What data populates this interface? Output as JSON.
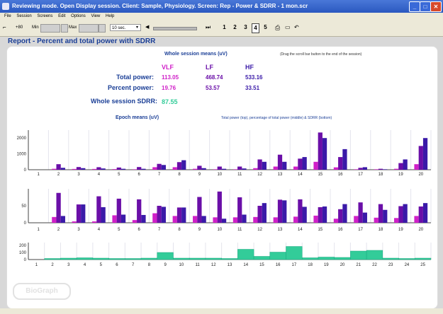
{
  "window": {
    "title": "Reviewing mode. Open Display session. Client: Sample, Physiology. Screen: Rep - Power & SDRR - 1 mon.scr",
    "minimize_label": "_",
    "maximize_label": "□",
    "close_label": "✕"
  },
  "menu": {
    "items": [
      "File",
      "Session",
      "Screens",
      "Edit",
      "Options",
      "View",
      "Help"
    ]
  },
  "toolbar": {
    "gain_label": "+80",
    "min_label": "Min",
    "max_label": "Max",
    "time_select": "10 sec.",
    "pages": [
      "1",
      "2",
      "3",
      "4",
      "5"
    ],
    "selected_page": "4"
  },
  "report_title": "Report - Percent and total power with SDRR",
  "stats": {
    "header": "Whole session means (uV)",
    "drag_hint": "(Drag the scroll bar button to the end of the session)",
    "columns": [
      "VLF",
      "LF",
      "HF"
    ],
    "rows": [
      {
        "label": "Total power:",
        "values": [
          "113.05",
          "468.74",
          "533.16"
        ]
      },
      {
        "label": "Percent power:",
        "values": [
          "19.76",
          "53.57",
          "33.51"
        ]
      }
    ],
    "sdrr_label": "Whole session SDRR:",
    "sdrr_value": "87.55"
  },
  "epoch_header": "Epoch means (uV)",
  "epoch_note": "Total power (top), percentage of total power (middle) & SDRR (bottom)",
  "logo_text": "BioGraph",
  "colors": {
    "vlf": "#d020c8",
    "lf": "#6a0fa8",
    "hf": "#3a1aa8",
    "sdrr": "#33cc99",
    "title": "#1a3e96"
  },
  "chart_data": [
    {
      "type": "bar",
      "title": "Total power",
      "categories": [
        "1",
        "2",
        "3",
        "4",
        "5",
        "6",
        "7",
        "8",
        "9",
        "10",
        "11",
        "12",
        "13",
        "14",
        "15",
        "16",
        "17",
        "18",
        "19",
        "20"
      ],
      "ylim": [
        0,
        2500
      ],
      "yticks": [
        "2000",
        "1000",
        "0"
      ],
      "series": [
        {
          "name": "VLF",
          "values": [
            0,
            60,
            50,
            50,
            40,
            30,
            160,
            160,
            60,
            30,
            30,
            100,
            200,
            200,
            500,
            150,
            30,
            30,
            60,
            350
          ]
        },
        {
          "name": "LF",
          "values": [
            0,
            350,
            170,
            160,
            140,
            170,
            370,
            480,
            250,
            200,
            200,
            650,
            950,
            700,
            2350,
            800,
            120,
            60,
            420,
            1500
          ]
        },
        {
          "name": "HF",
          "values": [
            0,
            120,
            100,
            80,
            60,
            60,
            300,
            600,
            100,
            60,
            80,
            500,
            500,
            800,
            2000,
            1300,
            160,
            30,
            650,
            2000
          ]
        }
      ]
    },
    {
      "type": "bar",
      "title": "Percent power",
      "categories": [
        "1",
        "2",
        "3",
        "4",
        "5",
        "6",
        "7",
        "8",
        "9",
        "10",
        "11",
        "12",
        "13",
        "14",
        "15",
        "16",
        "17",
        "18",
        "19",
        "20"
      ],
      "ylim": [
        0,
        100
      ],
      "yticks": [
        "50",
        "0"
      ],
      "series": [
        {
          "name": "VLF",
          "values": [
            0,
            17,
            4,
            4,
            22,
            8,
            28,
            20,
            20,
            16,
            16,
            17,
            16,
            18,
            21,
            12,
            20,
            15,
            14,
            20
          ]
        },
        {
          "name": "LF",
          "values": [
            0,
            88,
            54,
            78,
            71,
            69,
            50,
            45,
            76,
            92,
            75,
            50,
            68,
            69,
            46,
            40,
            60,
            55,
            49,
            48
          ]
        },
        {
          "name": "HF",
          "values": [
            0,
            20,
            54,
            46,
            24,
            23,
            47,
            45,
            20,
            12,
            24,
            58,
            66,
            47,
            48,
            55,
            30,
            38,
            55,
            58
          ]
        }
      ]
    },
    {
      "type": "bar",
      "title": "SDRR",
      "categories": [
        "1",
        "2",
        "3",
        "4",
        "5",
        "6",
        "7",
        "8",
        "9",
        "10",
        "11",
        "12",
        "13",
        "14",
        "15",
        "16",
        "17",
        "18",
        "19",
        "20",
        "21",
        "22",
        "23",
        "24",
        "25"
      ],
      "ylim": [
        0,
        240
      ],
      "yticks": [
        "200",
        "100",
        "0"
      ],
      "series": [
        {
          "name": "SDRR",
          "values": [
            0,
            15,
            20,
            25,
            20,
            15,
            15,
            20,
            100,
            20,
            20,
            20,
            15,
            145,
            45,
            105,
            185,
            25,
            35,
            30,
            120,
            130,
            20,
            15,
            20
          ]
        }
      ]
    }
  ]
}
